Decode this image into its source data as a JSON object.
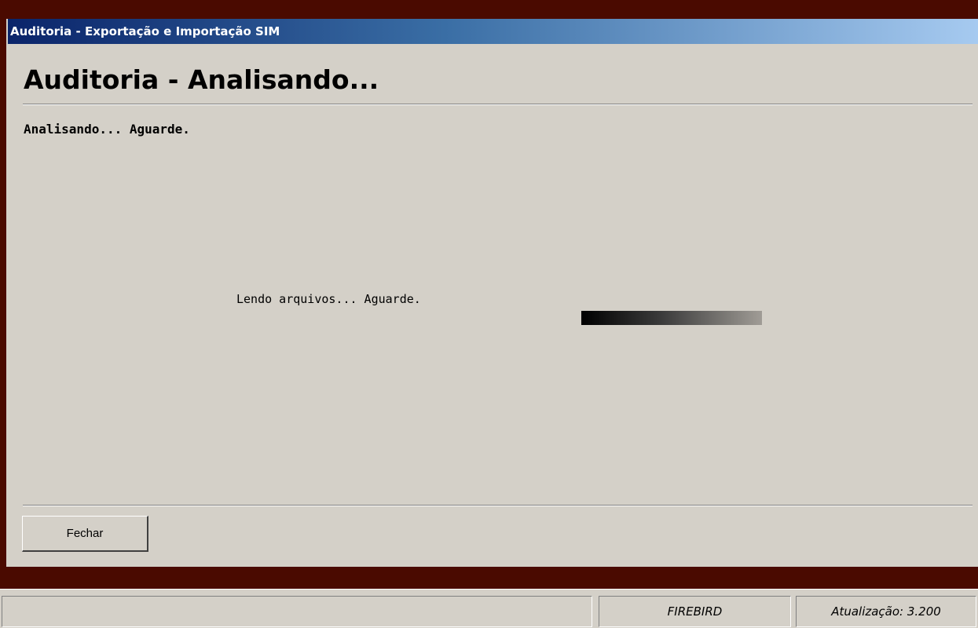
{
  "window": {
    "title": "Auditoria - Exportação e Importação SIM"
  },
  "page": {
    "title": "Auditoria - Analisando...",
    "subtitle": "Analisando... Aguarde."
  },
  "progress": {
    "message": "Lendo arquivos... Aguarde.",
    "percent": 100
  },
  "buttons": {
    "close_label": "Fechar"
  },
  "statusbar": {
    "main_text": "",
    "database": "FIREBIRD",
    "version": "Atualização: 3.200"
  },
  "colors": {
    "window_background": "#d4d0c8",
    "frame_dark_red": "#4a0a00",
    "titlebar_start": "#0a246a",
    "titlebar_end": "#a6caf0"
  }
}
